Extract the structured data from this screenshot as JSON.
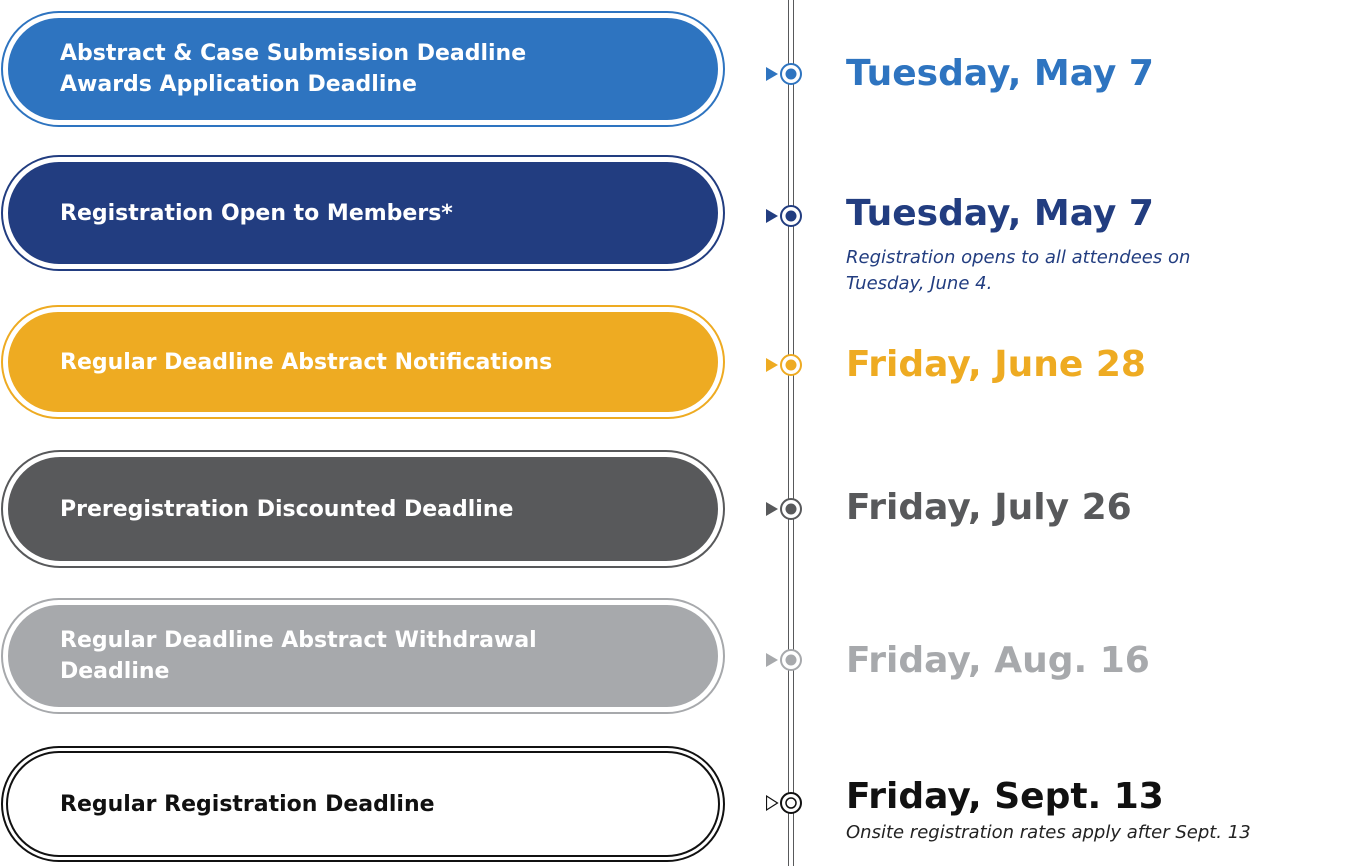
{
  "colors": {
    "blue": "#2e74c0",
    "navy": "#223d80",
    "gold": "#eeab22",
    "dark_gray": "#58595b",
    "light_gray": "#a7a9ac",
    "black": "#111111"
  },
  "items": [
    {
      "label_lines": [
        "Abstract & Case Submission Deadline",
        "Awards Application Deadline"
      ],
      "date": "Tuesday, May 7",
      "note_lines": []
    },
    {
      "label_lines": [
        "Registration Open to Members*"
      ],
      "date": "Tuesday, May 7",
      "note_lines": [
        "Registration opens to all attendees on",
        "Tuesday, June 4."
      ]
    },
    {
      "label_lines": [
        "Regular Deadline Abstract Notifications"
      ],
      "date": "Friday, June 28",
      "note_lines": []
    },
    {
      "label_lines": [
        "Preregistration Discounted Deadline"
      ],
      "date": "Friday, July 26",
      "note_lines": []
    },
    {
      "label_lines": [
        "Regular Deadline Abstract Withdrawal",
        "Deadline"
      ],
      "date": "Friday, Aug. 16",
      "note_lines": []
    },
    {
      "label_lines": [
        "Regular Registration Deadline"
      ],
      "date": "Friday, Sept. 13",
      "note_lines": [
        "Onsite registration rates apply after Sept. 13"
      ]
    }
  ]
}
